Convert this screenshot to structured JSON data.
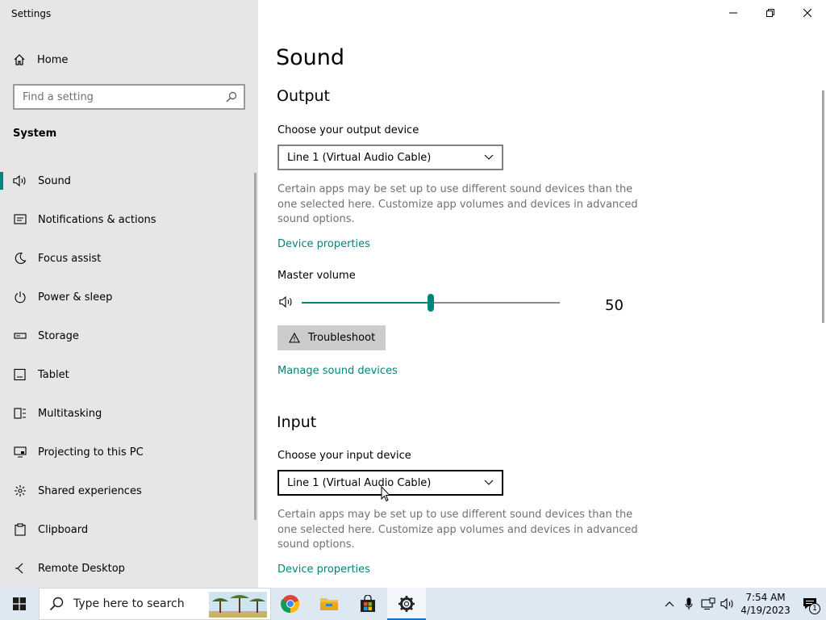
{
  "window": {
    "title": "Settings"
  },
  "sidebar": {
    "home_label": "Home",
    "search_placeholder": "Find a setting",
    "section_label": "System",
    "items": [
      {
        "label": "Sound",
        "icon": "speaker-icon",
        "active": true
      },
      {
        "label": "Notifications & actions",
        "icon": "notification-icon"
      },
      {
        "label": "Focus assist",
        "icon": "moon-icon"
      },
      {
        "label": "Power & sleep",
        "icon": "power-icon"
      },
      {
        "label": "Storage",
        "icon": "storage-icon"
      },
      {
        "label": "Tablet",
        "icon": "tablet-icon"
      },
      {
        "label": "Multitasking",
        "icon": "multitasking-icon"
      },
      {
        "label": "Projecting to this PC",
        "icon": "projector-icon"
      },
      {
        "label": "Shared experiences",
        "icon": "share-icon"
      },
      {
        "label": "Clipboard",
        "icon": "clipboard-icon"
      },
      {
        "label": "Remote Desktop",
        "icon": "remote-desktop-icon"
      }
    ]
  },
  "main": {
    "title": "Sound",
    "output": {
      "heading": "Output",
      "device_label": "Choose your output device",
      "device_value": "Line 1 (Virtual Audio Cable)",
      "description": "Certain apps may be set up to use different sound devices than the one selected here. Customize app volumes and devices in advanced sound options.",
      "device_properties_link": "Device properties",
      "master_volume_label": "Master volume",
      "master_volume_value": 50,
      "master_volume_text": "50",
      "troubleshoot_label": "Troubleshoot",
      "manage_devices_link": "Manage sound devices"
    },
    "input": {
      "heading": "Input",
      "device_label": "Choose your input device",
      "device_value": "Line 1 (Virtual Audio Cable)",
      "description": "Certain apps may be set up to use different sound devices than the one selected here. Customize app volumes and devices in advanced sound options.",
      "device_properties_link": "Device properties"
    }
  },
  "taskbar": {
    "search_placeholder": "Type here to search",
    "time": "7:54 AM",
    "date": "4/19/2023",
    "notification_count": "1"
  },
  "colors": {
    "accent": "#00857c",
    "sidebar_bg": "#e6e6e6",
    "taskbar_bg": "#dde8f3"
  }
}
